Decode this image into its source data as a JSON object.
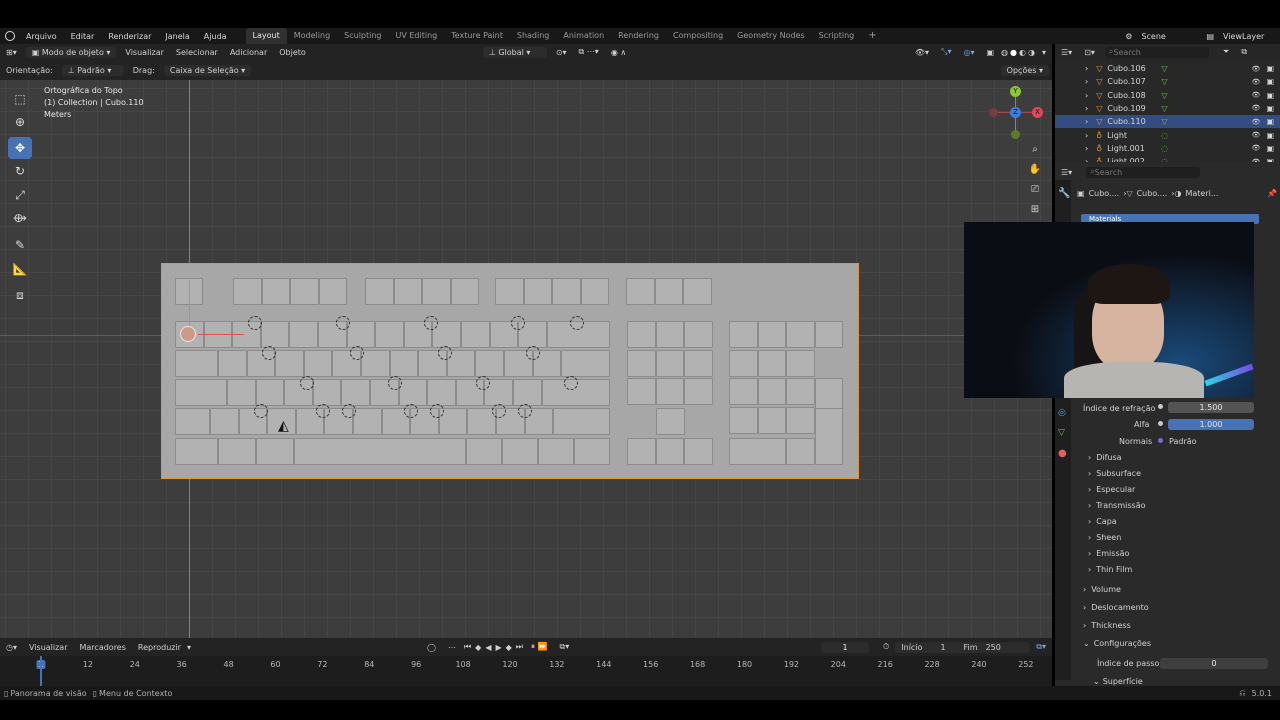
{
  "menubar": {
    "items": [
      "Arquivo",
      "Editar",
      "Renderizar",
      "Janela",
      "Ajuda"
    ],
    "workspaces": [
      "Layout",
      "Modeling",
      "Sculpting",
      "UV Editing",
      "Texture Paint",
      "Shading",
      "Animation",
      "Rendering",
      "Compositing",
      "Geometry Nodes",
      "Scripting"
    ],
    "active_workspace": "Layout",
    "add_tab": "+",
    "scene_label": "Scene",
    "view_layer_label": "ViewLayer"
  },
  "viewport_header": {
    "mode": "Modo de objeto",
    "menus": [
      "Visualizar",
      "Selecionar",
      "Adicionar",
      "Objeto"
    ],
    "transform_orientation": "Global"
  },
  "tool_settings": {
    "orientation_label": "Orientação:",
    "orientation_value": "Padrão",
    "drag_label": "Drag:",
    "drag_value": "Caixa de Seleção",
    "options": "Opções"
  },
  "viewport": {
    "view_name": "Ortográfica do Topo",
    "collection": "(1) Collection | Cubo.110",
    "units": "Meters"
  },
  "gizmo": {
    "x": "X",
    "y": "Y",
    "z": "Z"
  },
  "outliner": {
    "search_placeholder": "Search",
    "rows": [
      {
        "name": "Cubo.106",
        "kind": "mesh",
        "selected": false
      },
      {
        "name": "Cubo.107",
        "kind": "mesh",
        "selected": false
      },
      {
        "name": "Cubo.108",
        "kind": "mesh",
        "selected": false
      },
      {
        "name": "Cubo.109",
        "kind": "mesh",
        "selected": false
      },
      {
        "name": "Cubo.110",
        "kind": "mesh",
        "selected": true
      },
      {
        "name": "Light",
        "kind": "light",
        "selected": false
      },
      {
        "name": "Light.001",
        "kind": "light",
        "selected": false
      },
      {
        "name": "Light.002",
        "kind": "light",
        "selected": false
      }
    ]
  },
  "properties": {
    "search_placeholder": "Search",
    "breadcrumb": [
      "Cubo....",
      "Cubo....",
      "Materi..."
    ],
    "material_slot": "Materials",
    "fields": [
      {
        "label": "Índice de refração",
        "value": "1.500",
        "highlight": false
      },
      {
        "label": "Alfa",
        "value": "1.000",
        "highlight": true
      }
    ],
    "normals_label": "Normais",
    "normals_value": "Padrão",
    "sub_sections": [
      "Difusa",
      "Subsurface",
      "Especular",
      "Transmissão",
      "Capa",
      "Sheen",
      "Emissão",
      "Thin Film"
    ],
    "sections": [
      "Volume",
      "Deslocamento",
      "Thickness"
    ],
    "open_section": "Configurações",
    "pass_index_label": "Índice de passo",
    "pass_index_value": "0",
    "last_section": "Superfície"
  },
  "timeline": {
    "menus": [
      "Visualizar",
      "Marcadores",
      "Reproduzir"
    ],
    "current_frame": "1",
    "start_label": "Início",
    "start_value": "1",
    "end_label": "Fim",
    "end_value": "250",
    "ticks": [
      "1",
      "12",
      "24",
      "36",
      "48",
      "60",
      "72",
      "84",
      "96",
      "108",
      "120",
      "132",
      "144",
      "156",
      "168",
      "180",
      "192",
      "204",
      "216",
      "228",
      "240",
      "252"
    ]
  },
  "statusbar": {
    "pan": "Panorama de visão",
    "context": "Menu de Contexto",
    "version": "5.0.1"
  },
  "colors": {
    "accent": "#4772b3",
    "selection_outline": "#e0953c",
    "mesh_icon": "#e89a3a",
    "viewport_bg": "#3d3d3d"
  }
}
